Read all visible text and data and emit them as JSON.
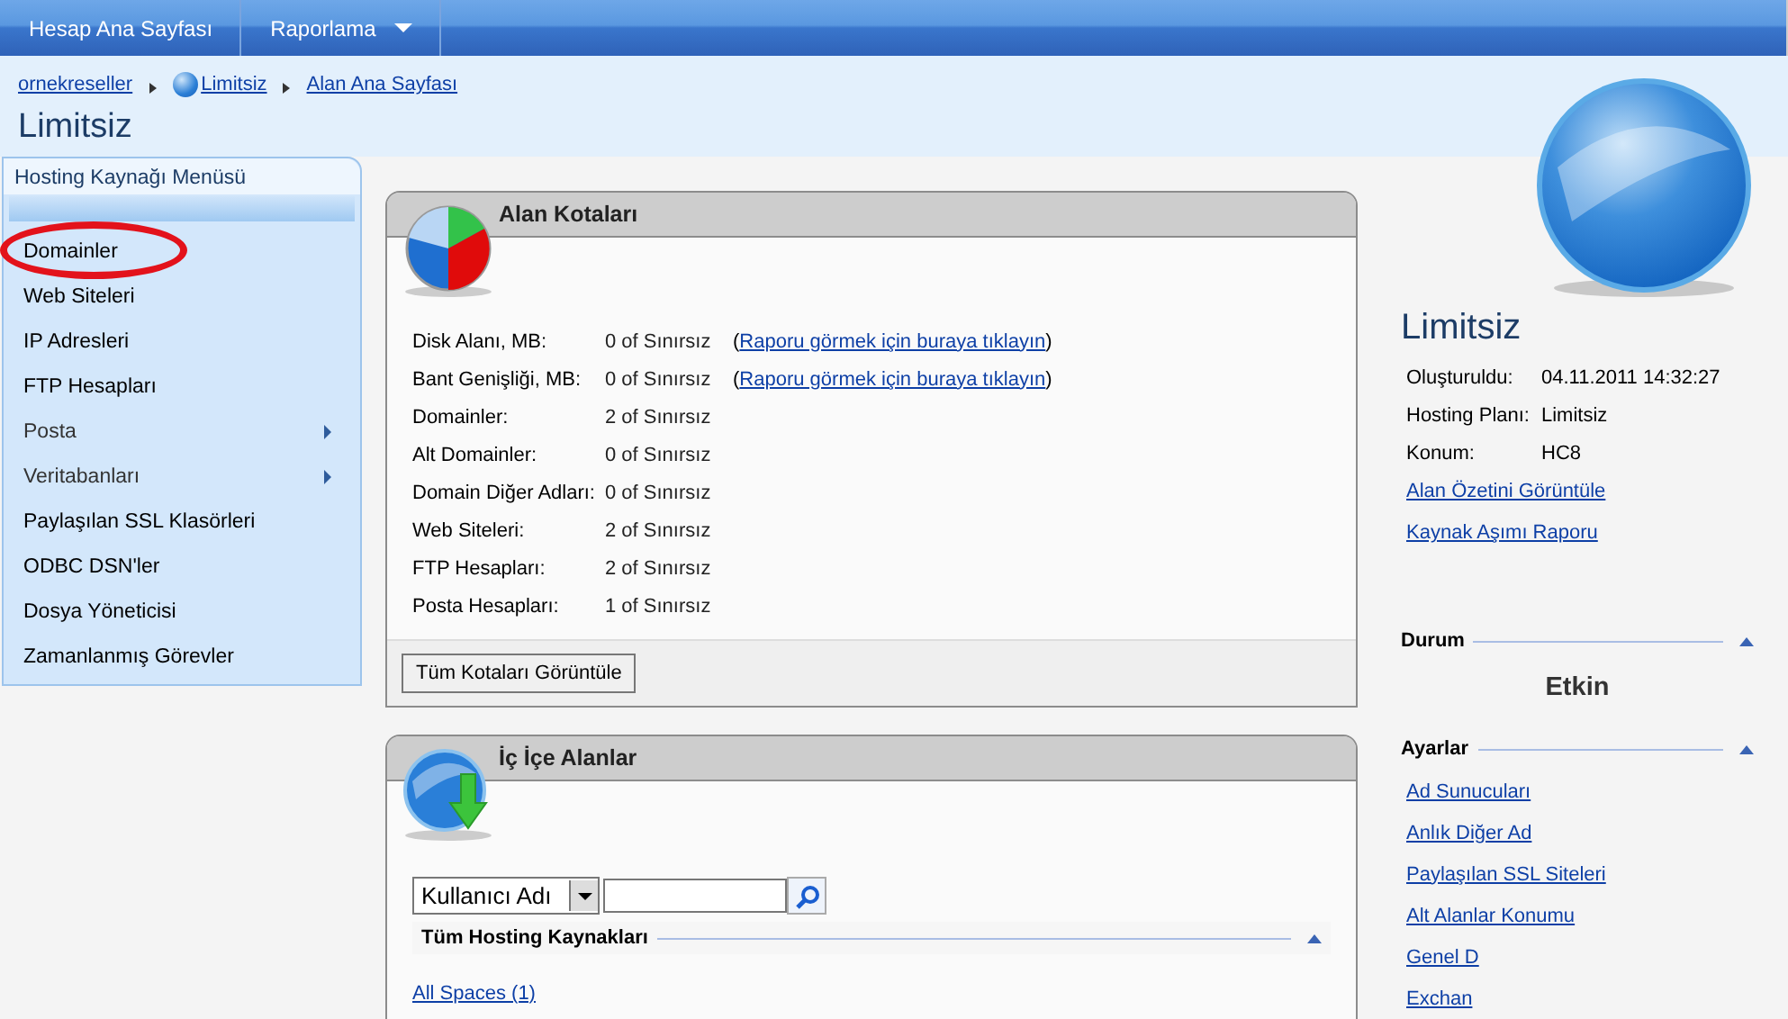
{
  "top_nav": [
    {
      "label": "Hesap Ana Sayfası",
      "has_dropdown": false
    },
    {
      "label": "Raporlama",
      "has_dropdown": true
    }
  ],
  "breadcrumb": [
    {
      "label": "ornekreseller",
      "has_icon": false
    },
    {
      "label": "Limitsiz",
      "has_icon": true
    },
    {
      "label": "Alan Ana Sayfası",
      "has_icon": false
    }
  ],
  "page_title": "Limitsiz",
  "sidebar": {
    "title": "Hosting Kaynağı Menüsü",
    "items": [
      {
        "label": "Domainler",
        "has_submenu": false,
        "circled": true
      },
      {
        "label": "Web Siteleri",
        "has_submenu": false,
        "circled": false
      },
      {
        "label": "IP Adresleri",
        "has_submenu": false,
        "circled": false
      },
      {
        "label": "FTP Hesapları",
        "has_submenu": false,
        "circled": false
      },
      {
        "label": "Posta",
        "has_submenu": true,
        "circled": false
      },
      {
        "label": "Veritabanları",
        "has_submenu": true,
        "circled": false
      },
      {
        "label": "Paylaşılan SSL Klasörleri",
        "has_submenu": false,
        "circled": false
      },
      {
        "label": "ODBC DSN'ler",
        "has_submenu": false,
        "circled": false
      },
      {
        "label": "Dosya Yöneticisi",
        "has_submenu": false,
        "circled": false
      },
      {
        "label": "Zamanlanmış Görevler",
        "has_submenu": false,
        "circled": false
      }
    ]
  },
  "quotas_panel": {
    "title": "Alan Kotaları",
    "rows": [
      {
        "label": "Disk Alanı, MB:",
        "value": "0 of Sınırsız",
        "link_open": "(",
        "link": "Raporu görmek için buraya tıklayın",
        "link_close": ")"
      },
      {
        "label": "Bant Genişliği, MB:",
        "value": "0 of Sınırsız",
        "link_open": "(",
        "link": "Raporu görmek için buraya tıklayın",
        "link_close": ")"
      },
      {
        "label": "Domainler:",
        "value": "2 of Sınırsız"
      },
      {
        "label": "Alt Domainler:",
        "value": "0 of Sınırsız"
      },
      {
        "label": "Domain Diğer Adları:",
        "value": "0 of Sınırsız"
      },
      {
        "label": "Web Siteleri:",
        "value": "2 of Sınırsız"
      },
      {
        "label": "FTP Hesapları:",
        "value": "2 of Sınırsız"
      },
      {
        "label": "Posta Hesapları:",
        "value": "1 of Sınırsız"
      }
    ],
    "button": "Tüm Kotaları Görüntüle"
  },
  "nested_panel": {
    "title": "İç İçe Alanlar",
    "search_by": "Kullanıcı Adı",
    "section": "Tüm Hosting Kaynakları",
    "link": "All Spaces (1)"
  },
  "details": {
    "title": "Limitsiz",
    "fields": [
      {
        "label": "Oluşturuldu:",
        "value": "04.11.2011 14:32:27"
      },
      {
        "label": "Hosting Planı:",
        "value": "Limitsiz"
      },
      {
        "label": "Konum:",
        "value": "HC8"
      }
    ],
    "links": [
      "Alan Özetini Görüntüle",
      "Kaynak Aşımı Raporu"
    ]
  },
  "status": {
    "title": "Durum",
    "value": "Etkin"
  },
  "settings": {
    "title": "Ayarlar",
    "links": [
      "Ad Sunucuları",
      "Anlık Diğer Ad",
      "Paylaşılan SSL Siteleri",
      "Alt Alanlar Konumu",
      "Genel D",
      "Exchan"
    ]
  }
}
